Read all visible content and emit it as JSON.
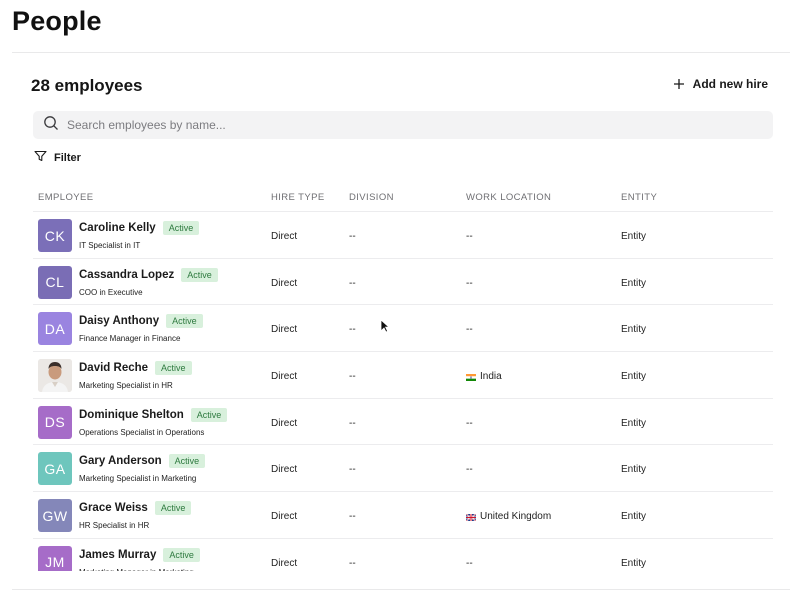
{
  "page": {
    "title": "People"
  },
  "section": {
    "count_label": "28 employees",
    "add_label": "Add new hire"
  },
  "search": {
    "placeholder": "Search employees by name..."
  },
  "filter": {
    "label": "Filter"
  },
  "table": {
    "columns": [
      "EMPLOYEE",
      "HIRE TYPE",
      "DIVISION",
      "WORK LOCATION",
      "ENTITY"
    ],
    "rows": [
      {
        "initials": "CK",
        "avatar_color": "#7b6fb8",
        "name": "Caroline Kelly",
        "status": "Active",
        "role": "IT Specialist in IT",
        "hire_type": "Direct",
        "division": "--",
        "location": "--",
        "flag": "",
        "entity": "Entity"
      },
      {
        "initials": "CL",
        "avatar_color": "#7a6db5",
        "name": "Cassandra Lopez",
        "status": "Active",
        "role": "COO in Executive",
        "hire_type": "Direct",
        "division": "--",
        "location": "--",
        "flag": "",
        "entity": "Entity"
      },
      {
        "initials": "DA",
        "avatar_color": "#9a84e0",
        "name": "Daisy Anthony",
        "status": "Active",
        "role": "Finance Manager in Finance",
        "hire_type": "Direct",
        "division": "--",
        "location": "--",
        "flag": "",
        "entity": "Entity"
      },
      {
        "initials": "",
        "avatar_color": "#e9e6e3",
        "name": "David Reche",
        "status": "Active",
        "role": "Marketing Specialist in HR",
        "hire_type": "Direct",
        "division": "--",
        "location": "India",
        "flag": "india",
        "entity": "Entity",
        "photo": true
      },
      {
        "initials": "DS",
        "avatar_color": "#a66cc8",
        "name": "Dominique Shelton",
        "status": "Active",
        "role": "Operations Specialist in Operations",
        "hire_type": "Direct",
        "division": "--",
        "location": "--",
        "flag": "",
        "entity": "Entity"
      },
      {
        "initials": "GA",
        "avatar_color": "#6ec6bd",
        "name": "Gary Anderson",
        "status": "Active",
        "role": "Marketing Specialist in Marketing",
        "hire_type": "Direct",
        "division": "--",
        "location": "--",
        "flag": "",
        "entity": "Entity"
      },
      {
        "initials": "GW",
        "avatar_color": "#8487b9",
        "name": "Grace Weiss",
        "status": "Active",
        "role": "HR Specialist in HR",
        "hire_type": "Direct",
        "division": "--",
        "location": "United Kingdom",
        "flag": "uk",
        "entity": "Entity"
      },
      {
        "initials": "JM",
        "avatar_color": "#a66cc8",
        "name": "James Murray",
        "status": "Active",
        "role": "Marketing Manager in Marketing",
        "hire_type": "Direct",
        "division": "--",
        "location": "--",
        "flag": "",
        "entity": "Entity"
      }
    ]
  },
  "icons": {
    "search": "search-icon",
    "plus": "plus-icon",
    "filter": "filter-icon",
    "cursor": "mouse-cursor-icon"
  }
}
